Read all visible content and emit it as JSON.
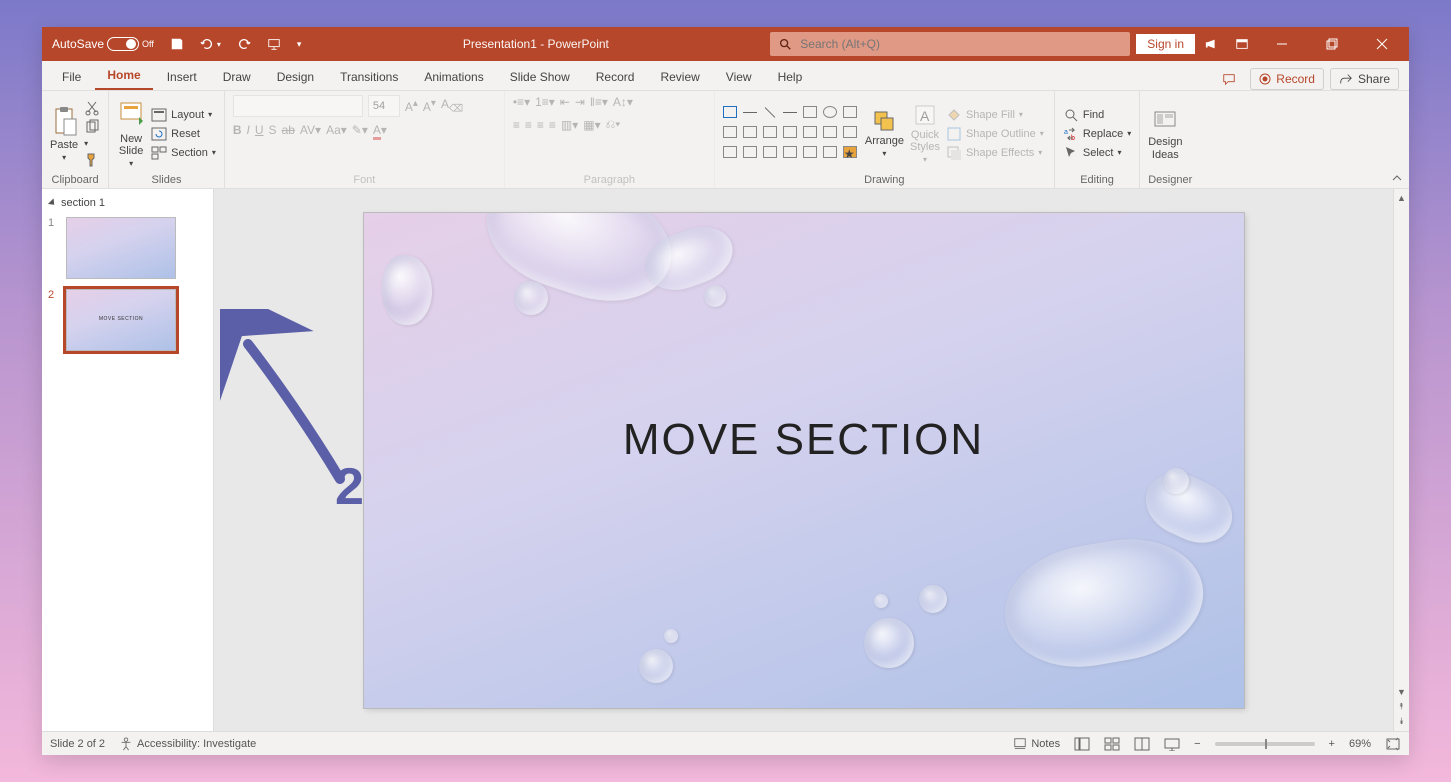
{
  "titlebar": {
    "autosave_label": "AutoSave",
    "autosave_state": "Off",
    "doc_title": "Presentation1 - PowerPoint",
    "search_placeholder": "Search (Alt+Q)",
    "signin": "Sign in"
  },
  "tabs": {
    "items": [
      "File",
      "Home",
      "Insert",
      "Draw",
      "Design",
      "Transitions",
      "Animations",
      "Slide Show",
      "Record",
      "Review",
      "View",
      "Help"
    ],
    "active_index": 1,
    "comments": "Comments",
    "record": "Record",
    "share": "Share"
  },
  "ribbon": {
    "clipboard": {
      "label": "Clipboard",
      "paste": "Paste"
    },
    "slides": {
      "label": "Slides",
      "new_slide": "New\nSlide",
      "layout": "Layout",
      "reset": "Reset",
      "section": "Section"
    },
    "font": {
      "label": "Font",
      "font_name": "",
      "font_size": "54"
    },
    "paragraph": {
      "label": "Paragraph"
    },
    "drawing": {
      "label": "Drawing",
      "arrange": "Arrange",
      "quick_styles": "Quick\nStyles",
      "shape_fill": "Shape Fill",
      "shape_outline": "Shape Outline",
      "shape_effects": "Shape Effects"
    },
    "editing": {
      "label": "Editing",
      "find": "Find",
      "replace": "Replace",
      "select": "Select"
    },
    "designer": {
      "label": "Designer",
      "design_ideas": "Design\nIdeas"
    }
  },
  "outline": {
    "section_name": "section 1",
    "slides": [
      {
        "num": "1",
        "title": ""
      },
      {
        "num": "2",
        "title": "MOVE SECTION"
      }
    ],
    "selected_index": 1
  },
  "annotation": {
    "number": "2"
  },
  "slide": {
    "title": "MOVE SECTION"
  },
  "status": {
    "slide_counter": "Slide 2 of 2",
    "accessibility": "Accessibility: Investigate",
    "notes": "Notes",
    "zoom": "69%"
  },
  "colors": {
    "accent": "#b7472a"
  }
}
